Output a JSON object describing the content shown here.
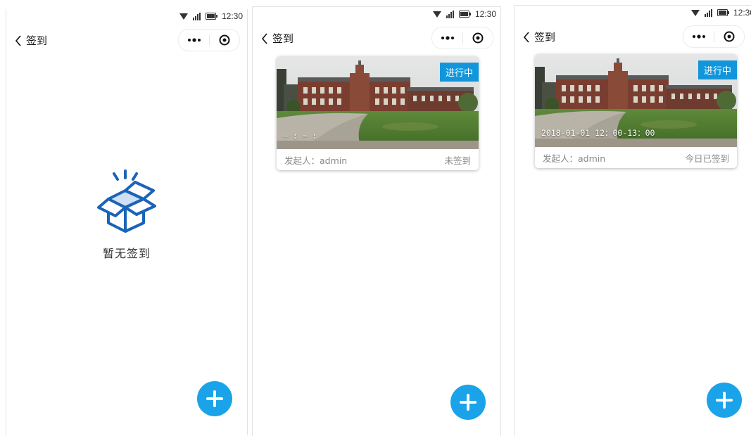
{
  "colors": {
    "accent": "#1296db",
    "fab": "#1aa3e8",
    "empty_icon": "#1a63b8"
  },
  "status": {
    "time": "12:30"
  },
  "nav": {
    "title": "签到"
  },
  "icons": {
    "back": "chevron-left-icon",
    "more": "more-dots-icon",
    "close": "record-circle-icon",
    "empty": "open-box-icon",
    "add": "plus-icon"
  },
  "screens": [
    {
      "empty_text": "暂无签到"
    },
    {
      "card": {
        "badge": "进行中",
        "time": "— : ~ :",
        "initiator": "发起人：admin",
        "state": "未签到"
      }
    },
    {
      "card": {
        "badge": "进行中",
        "time": "2018-01-01 12：00-13：00",
        "initiator": "发起人：admin",
        "state": "今日已签到"
      }
    }
  ]
}
